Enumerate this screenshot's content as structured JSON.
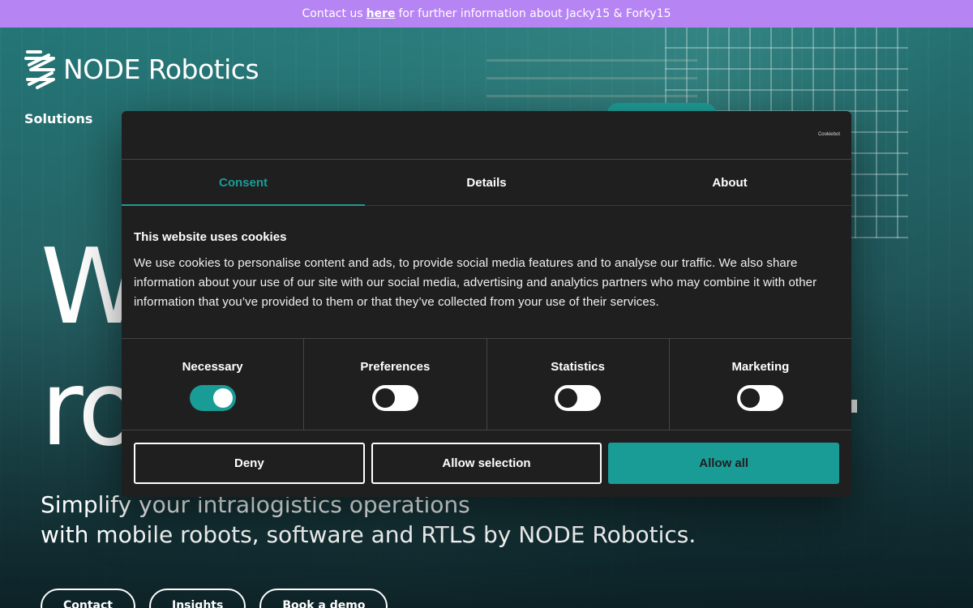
{
  "banner": {
    "prefix": "Contact us",
    "link": "here",
    "suffix": "for further information about Jacky15 & Forky15"
  },
  "header": {
    "logo_text": "NODE Robotics",
    "nav_solutions": "Solutions"
  },
  "hero": {
    "headline_line1": "W",
    "headline_line2": "ro",
    "subtitle_line1": "Simplify your intralogistics operations",
    "subtitle_line2": "with mobile robots, software and RTLS by NODE Robotics.",
    "buttons": [
      "Contact",
      "Insights",
      "Book a demo"
    ]
  },
  "cookie_dialog": {
    "powered_by": "Cookiebot",
    "tabs": [
      "Consent",
      "Details",
      "About"
    ],
    "active_tab": "Consent",
    "title": "This website uses cookies",
    "text": "We use cookies to personalise content and ads, to provide social media features and to analyse our traffic. We also share information about your use of our site with our social media, advertising and analytics partners who may combine it with other information that you’ve provided to them or that they’ve collected from your use of their services.",
    "categories": [
      {
        "label": "Necessary",
        "enabled": true
      },
      {
        "label": "Preferences",
        "enabled": false
      },
      {
        "label": "Statistics",
        "enabled": false
      },
      {
        "label": "Marketing",
        "enabled": false
      }
    ],
    "buttons": {
      "deny": "Deny",
      "allow_selection": "Allow selection",
      "allow_all": "Allow all"
    }
  },
  "colors": {
    "banner": "#b784f4",
    "accent": "#1a9c96",
    "dialog_bg": "#1f1f1f"
  }
}
